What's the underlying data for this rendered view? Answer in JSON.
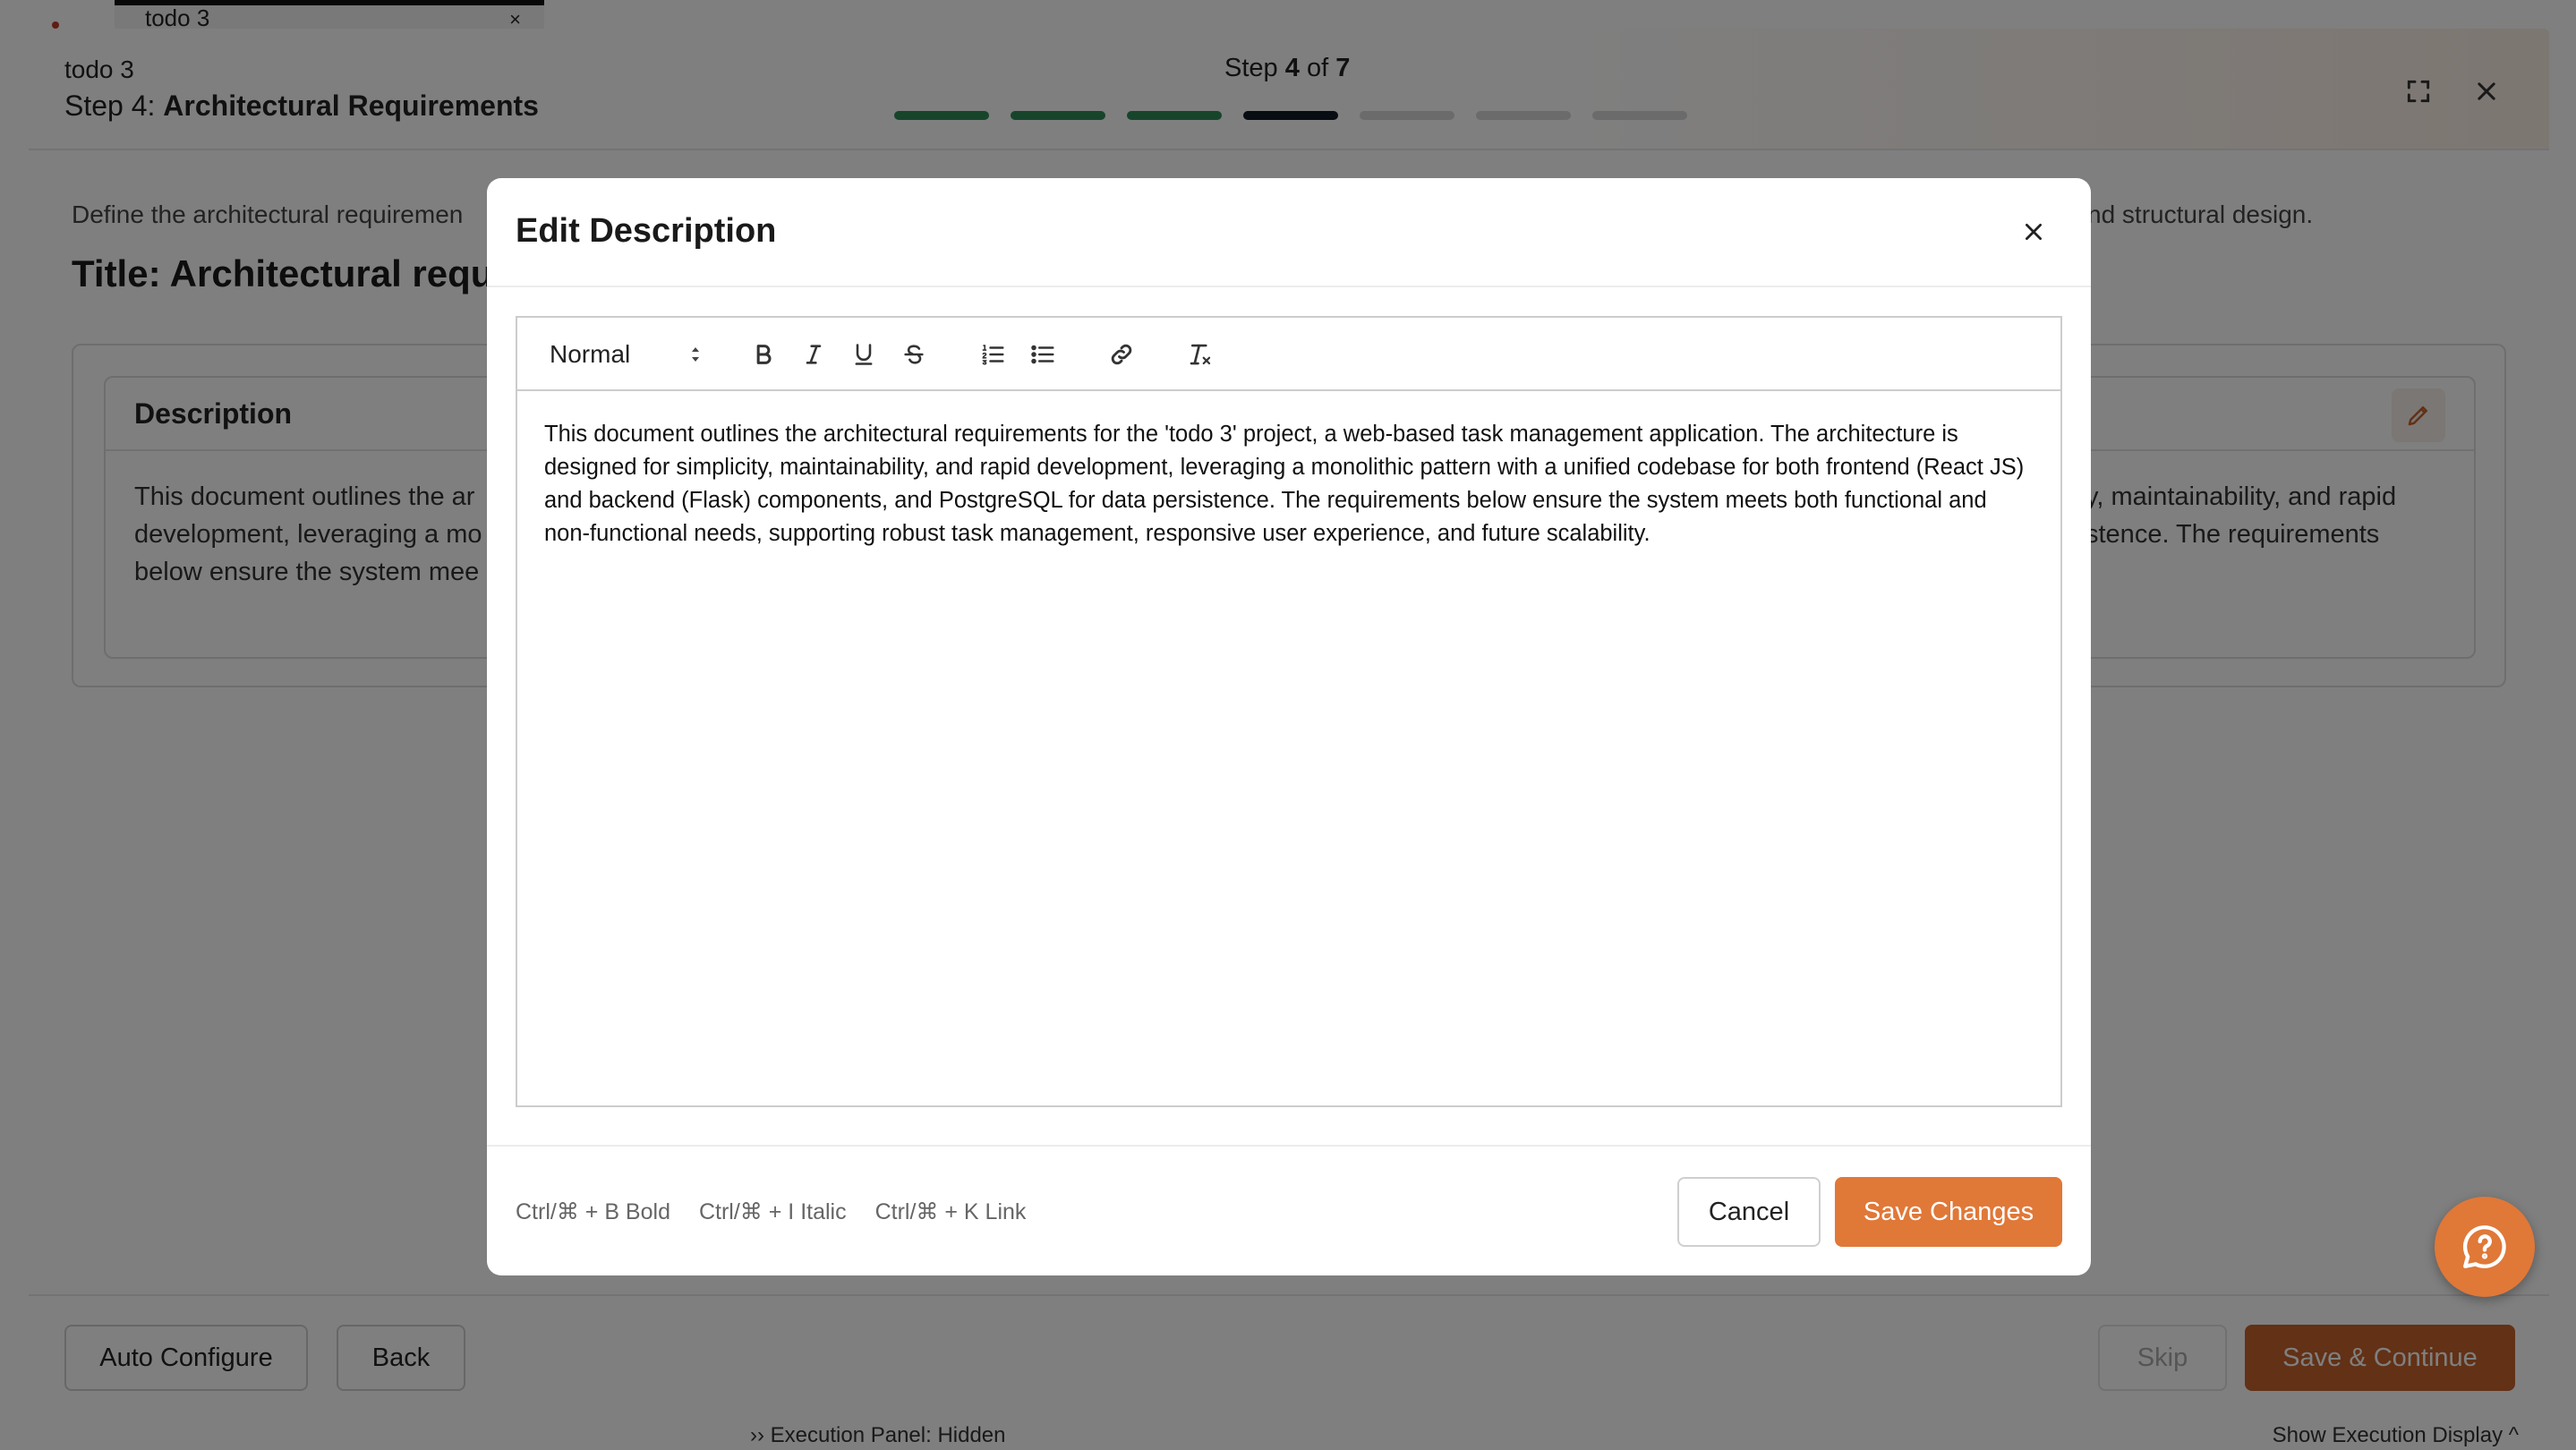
{
  "background": {
    "tab_title": "todo 3",
    "tab_close": "×",
    "bottom_left": "›› Execution Panel: Hidden",
    "bottom_right": "Show Execution Display ^"
  },
  "wizard": {
    "project_name": "todo 3",
    "step_prefix": "Step 4:",
    "step_name": "Architectural Requirements",
    "counter": {
      "prefix": "Step",
      "current": "4",
      "sep": "of",
      "total": "7"
    },
    "progress": [
      "done",
      "done",
      "done",
      "current",
      "pending",
      "pending",
      "pending"
    ],
    "description_left": "Define the architectural requiremen",
    "description_right": "nd structural design.",
    "title": "Title: Architectural requi",
    "card": {
      "label": "Description",
      "text_left": "This document outlines the ar",
      "text_left_2": "development, leveraging a mo",
      "text_left_3": "below ensure the system mee",
      "text_right": "y, maintainability, and rapid",
      "text_right_2": "stence. The requirements"
    },
    "footer": {
      "auto_configure": "Auto Configure",
      "back": "Back",
      "skip": "Skip",
      "save_continue": "Save & Continue"
    }
  },
  "modal": {
    "title": "Edit Description",
    "toolbar": {
      "format": "Normal"
    },
    "content": "This document outlines the architectural requirements for the 'todo 3' project, a web-based task management application. The architecture is designed for simplicity, maintainability, and rapid development, leveraging a monolithic pattern with a unified codebase for both frontend (React JS) and backend (Flask) components, and PostgreSQL for data persistence. The requirements below ensure the system meets both functional and non-functional needs, supporting robust task management, responsive user experience, and future scalability.",
    "shortcuts": [
      "Ctrl/⌘ + B Bold",
      "Ctrl/⌘ + I Italic",
      "Ctrl/⌘ + K Link"
    ],
    "cancel": "Cancel",
    "save": "Save Changes"
  },
  "colors": {
    "accent": "#e07838",
    "progress_done": "#2e8b57",
    "progress_current": "#111827"
  }
}
